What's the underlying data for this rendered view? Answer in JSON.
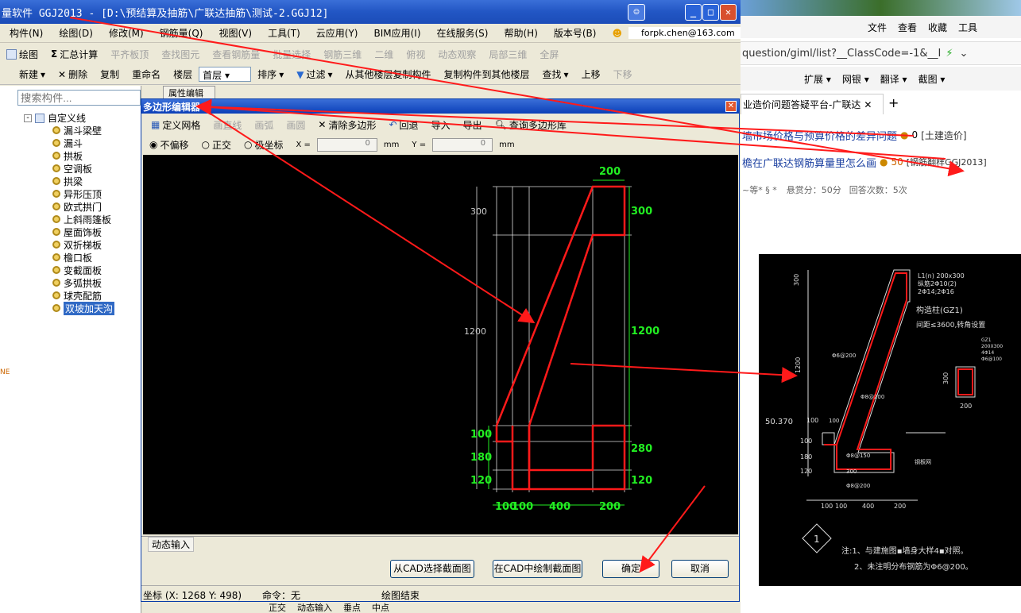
{
  "app": {
    "title": "造价软件 GGJ2013 - [D:\\预结算及抽筋\\广联达抽筋\\测试-2.GGJ12]",
    "title_visible": "量软件 GGJ2013 - [D:\\预结算及抽筋\\广联达抽筋\\测试-2.GGJ12]",
    "menu": [
      "构件(N)",
      "绘图(D)",
      "修改(M)",
      "钢筋量(Q)",
      "视图(V)",
      "工具(T)",
      "云应用(Y)",
      "BIM应用(I)",
      "在线服务(S)",
      "帮助(H)",
      "版本号(B)"
    ],
    "account": "forpk.chen@163.com",
    "toolbar1": [
      "绘图",
      "汇总计算",
      "平齐板顶",
      "查找图元",
      "查看钢筋量",
      "批量选择",
      "钢筋三维",
      "二维",
      "俯视",
      "动态观察",
      "局部三维",
      "全屏"
    ],
    "toolbar2": [
      "新建",
      "删除",
      "复制",
      "重命名",
      "楼层",
      "首层",
      "排序",
      "过滤",
      "从其他楼层复制构件",
      "复制构件到其他楼层",
      "查找",
      "上移",
      "下移"
    ],
    "search_placeholder": "搜索构件...",
    "prop_tab": "属性编辑",
    "tree_root": "自定义线",
    "tree_items": [
      "漏斗梁壁",
      "漏斗",
      "拱板",
      "空调板",
      "拱梁",
      "异形压顶",
      "欧式拱门",
      "上斜雨篷板",
      "屋面饰板",
      "双折梯板",
      "檐口板",
      "变截面板",
      "多弧拱板",
      "球壳配筋",
      "双坡加天沟"
    ],
    "side_label": "NE"
  },
  "dialog": {
    "title": "多边形编辑器",
    "toolbar": [
      "定义网格",
      "画直线",
      "画弧",
      "画圆",
      "清除多边形",
      "回退",
      "导入",
      "导出",
      "查询多边形库"
    ],
    "options": [
      "不偏移",
      "正交",
      "极坐标"
    ],
    "x_label": "X =",
    "y_label": "Y =",
    "x_value": "0",
    "y_value": "0",
    "unit": "mm",
    "dynamic_input": "动态输入",
    "buttons": [
      "从CAD选择截面图",
      "在CAD中绘制截面图",
      "确定",
      "取消"
    ],
    "status_coords": "坐标 (X: 1268 Y: 498)",
    "status_cmd": "命令：无",
    "status_msg": "绘图结束"
  },
  "drawing": {
    "white_dims": [
      "300",
      "1200"
    ],
    "green_right": [
      "300",
      "1200",
      "280",
      "120"
    ],
    "green_left": [
      "100",
      "180",
      "120"
    ],
    "green_top": "200",
    "green_bottom": [
      "100",
      "100",
      "400",
      "200"
    ]
  },
  "browser": {
    "menu": [
      "文件",
      "查看",
      "收藏",
      "工具"
    ],
    "address": "question/giml/list?__ClassCode=-1&__I",
    "toolbar": [
      "扩展",
      "网银",
      "翻译",
      "截图"
    ],
    "tab": "业造价问题答疑平台-广联达",
    "q1": "墙市场价格与预算价格的差异问题",
    "q1_score": "0",
    "q1_tag": "[土建造价]",
    "q2": "檐在广联达钢筋算量里怎么画",
    "q2_score": "50",
    "q2_tag": "[钢筋翻样GGJ2013]",
    "meta": "~等* § *",
    "reward": "悬赏分：50分",
    "answers": "回答次数：5次"
  },
  "cad": {
    "dims_v": [
      "300",
      "1200",
      "100",
      "180",
      "120"
    ],
    "dims_h": [
      "100",
      "100",
      "400",
      "200"
    ],
    "elev": "50.370",
    "c1": "L1(n) 200x300",
    "c2": "纵筋2Φ10(2)",
    "c3": "2Φ14;2Φ16",
    "gz": "构造柱(GZ1)",
    "gz_note": "间距≤3600,转角设置",
    "gz1": "GZ1",
    "gz1_size": "200X300",
    "gz1_bars": "4Φ14",
    "gz1_stir": "Φ6@100",
    "d300": "300",
    "d200": "200",
    "r1": "Φ6@200",
    "r2": "Φ8@200",
    "r3": "Φ8@150",
    "r4": "Φ8@200",
    "r5": "300",
    "r6": "钢板网",
    "t1": "100",
    "t2": "100",
    "num": "1",
    "note1": "注:1、与建施图▪墙身大样4▪对照。",
    "note2": "2、未注明分布钢筋为Φ6@200。"
  },
  "bottom": [
    "正交",
    "动态输入",
    "垂点",
    "中点"
  ],
  "colors": {
    "accent_red": "#ff1a1a",
    "dim_green": "#22ee22",
    "title_blue": "#2256c4"
  }
}
